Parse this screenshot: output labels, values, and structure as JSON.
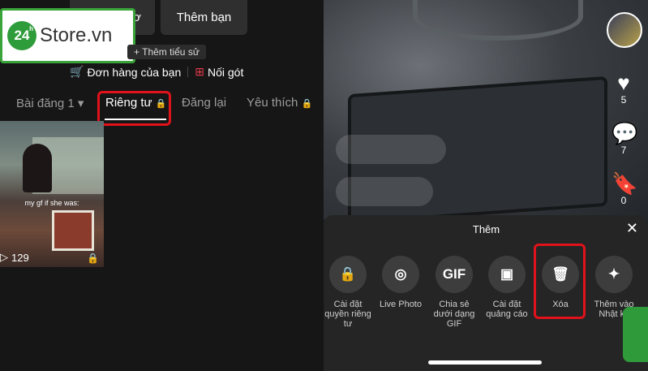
{
  "left": {
    "buttons": {
      "edit_profile": "Sửa hồ sơ",
      "add_friend": "Thêm bạn"
    },
    "logo": {
      "number": "24",
      "sup": "h",
      "text": "Store.vn"
    },
    "bio": "+ Thêm tiểu sử",
    "links": {
      "orders": "Đơn hàng của bạn",
      "feature": "Nối gót"
    },
    "tabs": [
      "Bài đăng 1",
      "Riêng tư",
      "Đăng lại",
      "Yêu thích"
    ],
    "active_tab": "Riêng tư",
    "video": {
      "caption": "my gf if she was:",
      "views": "129"
    }
  },
  "right": {
    "counts": {
      "likes": "5",
      "comments": "7",
      "saves": "0"
    },
    "sheet": {
      "title": "Thêm",
      "options": [
        {
          "icon": "lock-icon",
          "label": "Cài đặt quyền riêng tư"
        },
        {
          "icon": "live-photo-icon",
          "label": "Live Photo"
        },
        {
          "icon": "gif-icon",
          "label": "Chia sẻ dưới dạng GIF",
          "glyph": "GIF"
        },
        {
          "icon": "ad-settings-icon",
          "label": "Cài đặt quảng cáo"
        },
        {
          "icon": "trash-icon",
          "label": "Xóa"
        },
        {
          "icon": "sparkle-icon",
          "label": "Thêm vào Nhật ký"
        }
      ]
    }
  },
  "colors": {
    "highlight": "#e0121a",
    "brand_green": "#2e9c3a"
  }
}
